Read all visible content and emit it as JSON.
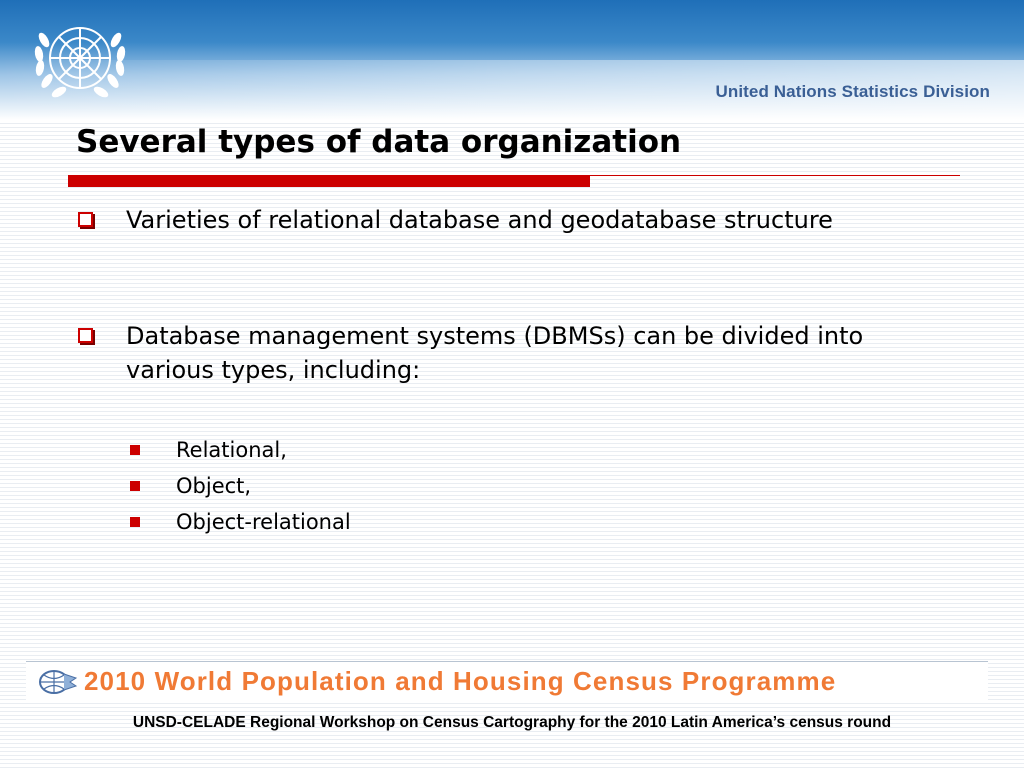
{
  "header": {
    "organization": "United Nations Statistics Division",
    "emblem_icon": "un-emblem-icon"
  },
  "slide": {
    "title": "Several types of data organization",
    "bullets": [
      {
        "text": "Varieties of relational database and geodatabase structure"
      },
      {
        "text": "Database management systems (DBMSs) can be divided into various types, including:"
      }
    ],
    "sub_bullets": [
      {
        "text": "Relational,"
      },
      {
        "text": "Object,"
      },
      {
        "text": "Object-relational"
      }
    ]
  },
  "banner": {
    "text": "2010 World Population and Housing Census Programme",
    "logo_icon": "census-globe-logo-icon"
  },
  "footer": {
    "text": "UNSD-CELADE Regional Workshop on Census Cartography for the 2010 Latin America’s census round"
  },
  "colors": {
    "accent_red": "#cc0000",
    "header_blue": "#1f6fb8",
    "division_text": "#3a5f95",
    "banner_orange": "#f07a35"
  }
}
